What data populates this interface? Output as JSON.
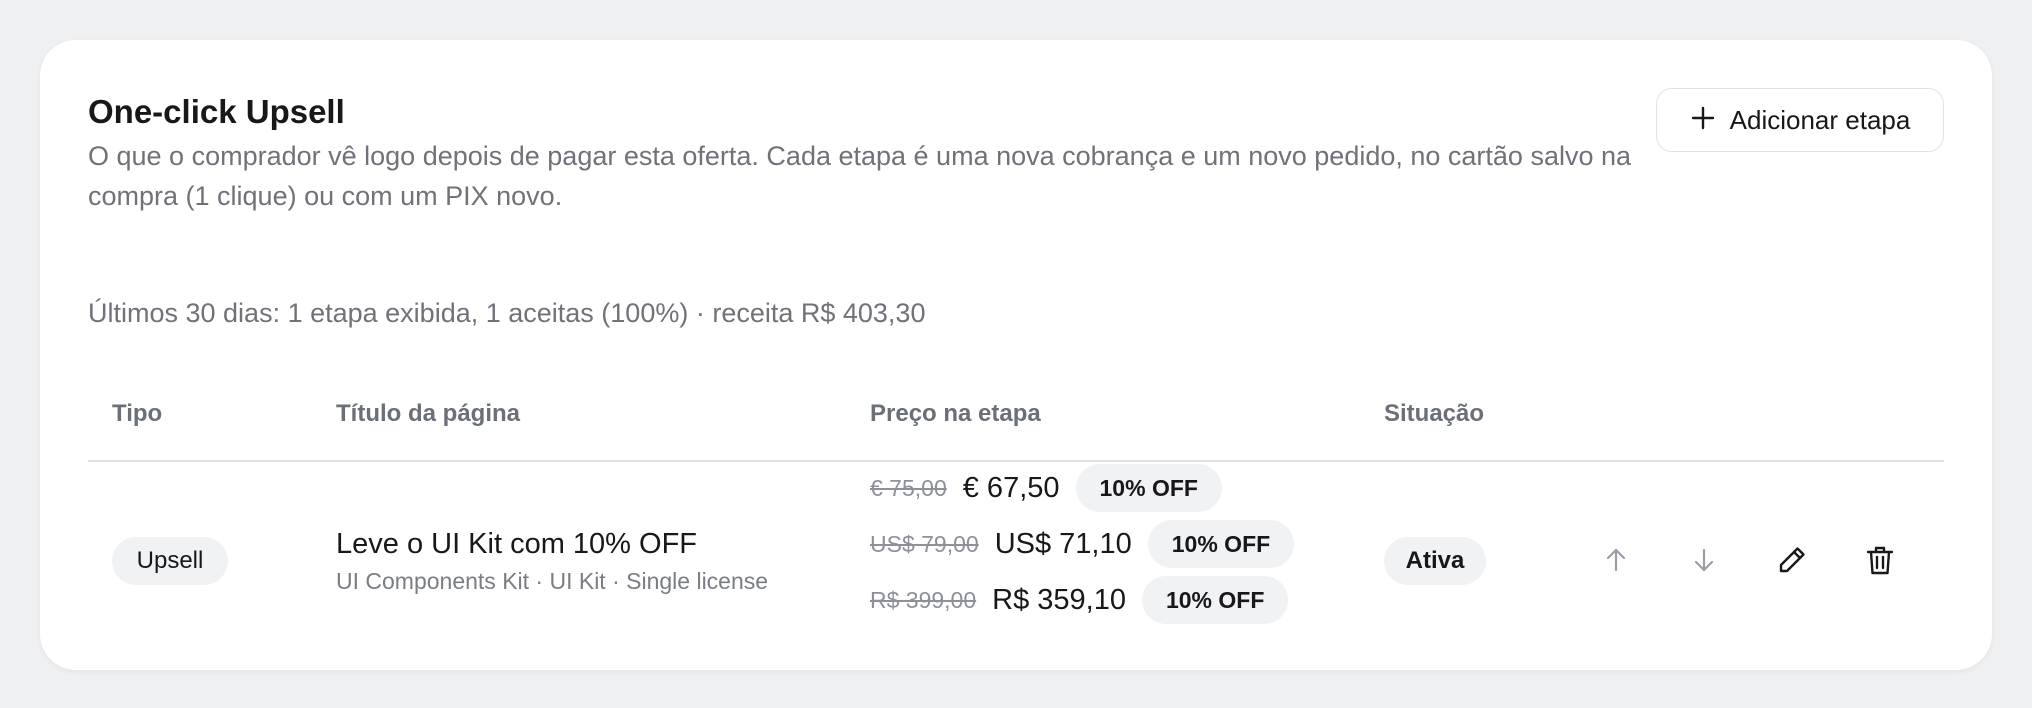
{
  "section": {
    "title": "One-click Upsell",
    "description": "O que o comprador vê logo depois de pagar esta oferta. Cada etapa é uma nova cobrança e um novo pedido, no cartão salvo na compra (1 clique) ou com um PIX novo.",
    "stats": "Últimos 30 dias: 1 etapa exibida, 1 aceitas (100%) · receita R$ 403,30",
    "add_button": {
      "icon": "plus-icon",
      "label": "Adicionar etapa"
    }
  },
  "table": {
    "headers": {
      "type": "Tipo",
      "page_title": "Título da página",
      "price": "Preço na etapa",
      "status": "Situação"
    },
    "rows": [
      {
        "type": "Upsell",
        "page_title": "Leve o UI Kit com 10% OFF",
        "page_subtitle": "UI Components Kit · UI Kit · Single license",
        "prices": [
          {
            "old": "€ 75,00",
            "new": "€ 67,50",
            "discount": "10% OFF"
          },
          {
            "old": "US$ 79,00",
            "new": "US$ 71,10",
            "discount": "10% OFF"
          },
          {
            "old": "R$ 399,00",
            "new": "R$ 359,10",
            "discount": "10% OFF"
          }
        ],
        "status": "Ativa",
        "actions": [
          "arrow-up-icon",
          "arrow-down-icon",
          "pencil-icon",
          "trash-icon"
        ]
      }
    ]
  }
}
